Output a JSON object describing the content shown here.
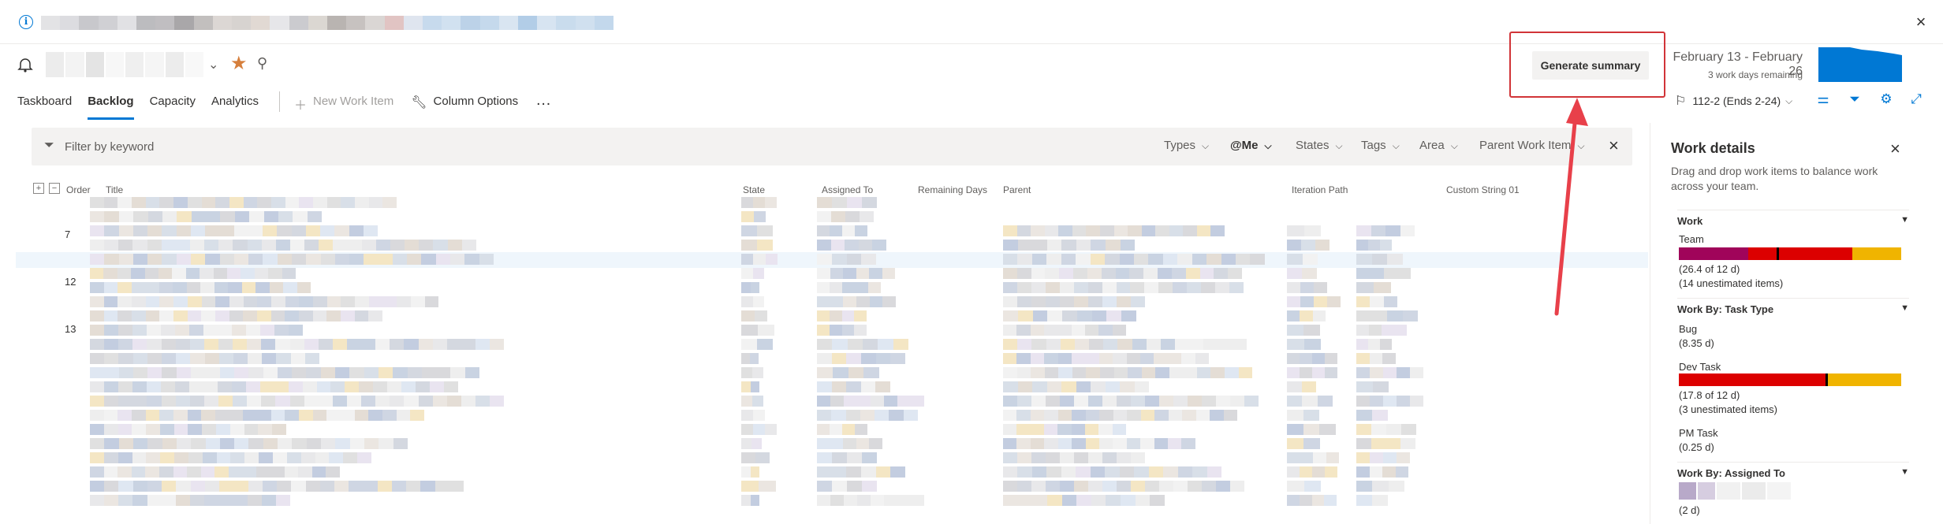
{
  "banner": {
    "info_icon": "info-icon",
    "close_icon": "close-icon",
    "redacted_colors": [
      "#e3e3e5",
      "#dcdce0",
      "#c8c8cc",
      "#d0d0d4",
      "#e1e1e4",
      "#bcbcbf",
      "#c0bec1",
      "#a9a7a9",
      "#c2bfbe",
      "#dcd7d4",
      "#d7d3d0",
      "#e1d9d3",
      "#e6e6e9",
      "#cbcbcf",
      "#dbd7d2",
      "#b9b4b1",
      "#c7c2c0",
      "#dad6d4",
      "#e1c4c3",
      "#dfe5ef",
      "#c7daed",
      "#d1e1f0",
      "#bcd2e8",
      "#c5d9ec",
      "#d9e5f1",
      "#b2cde7",
      "#d7e4f1",
      "#c9dced",
      "#d0e0ef",
      "#c3d8ec"
    ]
  },
  "header": {
    "team_icon": "team-bell-icon",
    "team_name_colors": [
      "#ececec",
      "#f3f3f3",
      "#e4e4e4",
      "#f7f7f7",
      "#efefef",
      "#f5f5f5",
      "#ececec",
      "#f8f8f8"
    ],
    "chevron_icon": "chevron-down-icon",
    "star_icon": "star-icon",
    "members_icon": "team-members-icon",
    "generate_summary_label": "Generate summary",
    "sprint_dates": "February 13 - February 26",
    "sprint_remaining": "3 work days remaining",
    "burndown_color": "#0078d4"
  },
  "tabs": [
    {
      "label": "Taskboard",
      "active": false
    },
    {
      "label": "Backlog",
      "active": true
    },
    {
      "label": "Capacity",
      "active": false
    },
    {
      "label": "Analytics",
      "active": false
    }
  ],
  "commands": {
    "new_work_item": "New Work Item",
    "column_options": "Column Options",
    "more": "…"
  },
  "iteration": {
    "label": "112-2 (Ends 2-24)"
  },
  "toolbar_icons": [
    "view-options-icon",
    "filter-icon",
    "settings-icon",
    "fullscreen-icon"
  ],
  "filter": {
    "placeholder": "Filter by keyword",
    "types": "Types",
    "me": "@Me",
    "states": "States",
    "tags": "Tags",
    "area": "Area",
    "parent": "Parent Work Item"
  },
  "grid": {
    "columns": {
      "order": "Order",
      "title": "Title",
      "state": "State",
      "assigned": "Assigned To",
      "remaining": "Remaining Days",
      "parent": "Parent",
      "iteration": "Iteration Path",
      "custom": "Custom String 01"
    },
    "orders": [
      "7",
      "12",
      "13"
    ]
  },
  "panel": {
    "title": "Work details",
    "description": "Drag and drop work items to balance work across your team.",
    "work_section": "Work",
    "team_label": "Team",
    "team_value": "(26.4 of 12 d)",
    "team_unestimated": "(14 unestimated items)",
    "task_type_section": "Work By: Task Type",
    "bug_label": "Bug",
    "bug_value": "(8.35 d)",
    "dev_label": "Dev Task",
    "dev_value": "(17.8 of 12 d)",
    "dev_unestimated": "(3 unestimated items)",
    "pm_label": "PM Task",
    "pm_value": "(0.25 d)",
    "assigned_section": "Work By: Assigned To",
    "assigned_value": "(2 d)",
    "colors": {
      "purple": "#a0045a",
      "red": "#dc0000",
      "yellow": "#f0b400"
    }
  }
}
